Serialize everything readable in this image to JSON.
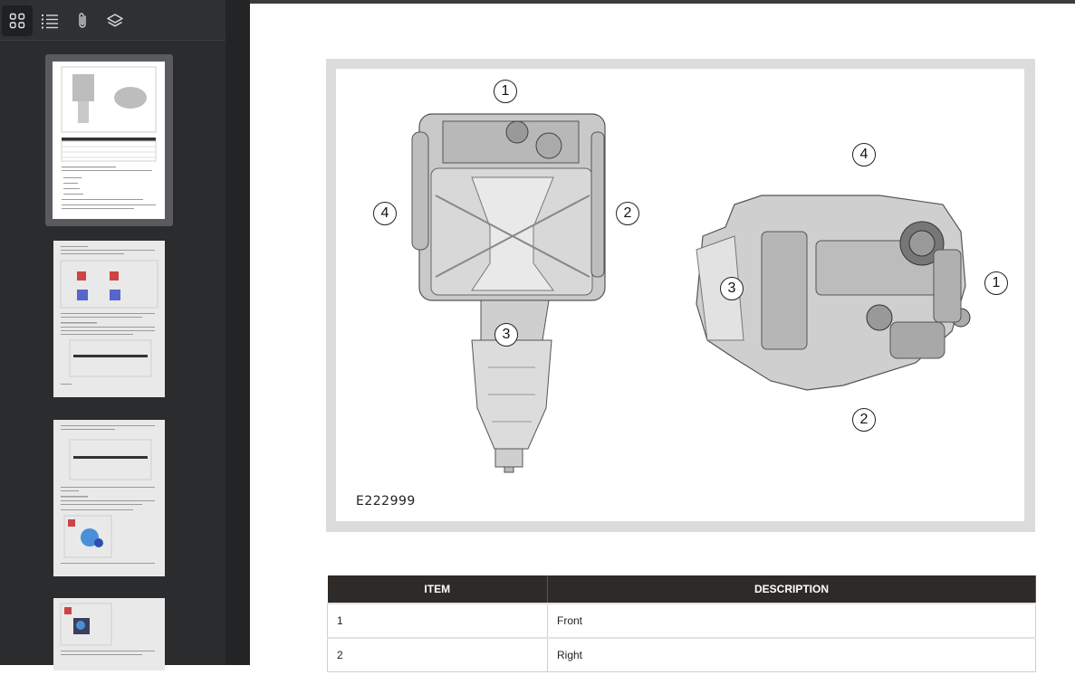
{
  "sidebar": {
    "tools": [
      {
        "icon": "thumbnails-grid-icon"
      },
      {
        "icon": "outline-list-icon"
      },
      {
        "icon": "attachment-paperclip-icon"
      },
      {
        "icon": "layers-icon"
      }
    ],
    "selected_page": 1
  },
  "figure": {
    "code": "E222999",
    "left_view_callouts": [
      "1",
      "2",
      "3",
      "4"
    ],
    "right_view_callouts": [
      "4",
      "1",
      "3",
      "2"
    ]
  },
  "table": {
    "headers": [
      "ITEM",
      "DESCRIPTION"
    ],
    "rows": [
      {
        "item": "1",
        "description": "Front"
      },
      {
        "item": "2",
        "description": "Right"
      }
    ]
  }
}
